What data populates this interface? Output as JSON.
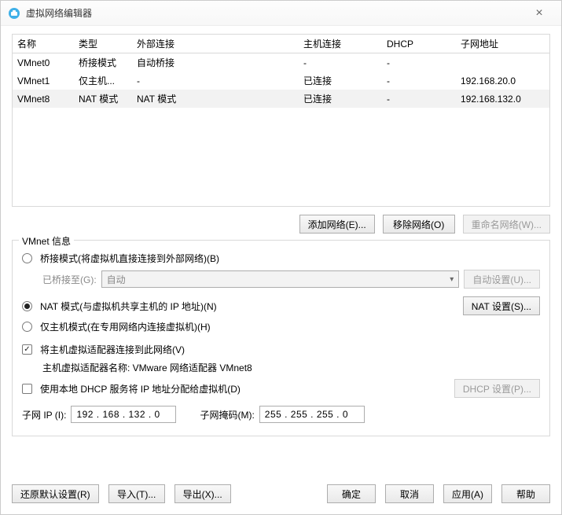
{
  "window": {
    "title": "虚拟网络编辑器"
  },
  "table": {
    "headers": {
      "name": "名称",
      "type": "类型",
      "ext": "外部连接",
      "host": "主机连接",
      "dhcp": "DHCP",
      "subnet": "子网地址"
    },
    "rows": [
      {
        "name": "VMnet0",
        "type": "桥接模式",
        "ext": "自动桥接",
        "host": "-",
        "dhcp": "-",
        "subnet": ""
      },
      {
        "name": "VMnet1",
        "type": "仅主机...",
        "ext": "-",
        "host": "已连接",
        "dhcp": "-",
        "subnet": "192.168.20.0"
      },
      {
        "name": "VMnet8",
        "type": "NAT 模式",
        "ext": "NAT 模式",
        "host": "已连接",
        "dhcp": "-",
        "subnet": "192.168.132.0"
      }
    ]
  },
  "netButtons": {
    "add": "添加网络(E)...",
    "remove": "移除网络(O)",
    "rename": "重命名网络(W)..."
  },
  "groupTitle": "VMnet 信息",
  "mode": {
    "bridge": "桥接模式(将虚拟机直接连接到外部网络)(B)",
    "bridgedToLabel": "已桥接至(G):",
    "bridgedToValue": "自动",
    "autoSet": "自动设置(U)...",
    "nat": "NAT 模式(与虚拟机共享主机的 IP 地址)(N)",
    "natSet": "NAT 设置(S)...",
    "hostonly": "仅主机模式(在专用网络内连接虚拟机)(H)"
  },
  "hostAdapter": {
    "check": "将主机虚拟适配器连接到此网络(V)",
    "nameLine": "主机虚拟适配器名称: VMware 网络适配器 VMnet8"
  },
  "dhcp": {
    "check": "使用本地 DHCP 服务将 IP 地址分配给虚拟机(D)",
    "set": "DHCP 设置(P)..."
  },
  "ip": {
    "subnetLabel": "子网 IP (I):",
    "subnetValue": "192 . 168 . 132 .   0",
    "maskLabel": "子网掩码(M):",
    "maskValue": "255 . 255 . 255 .   0"
  },
  "footer": {
    "restore": "还原默认设置(R)",
    "import": "导入(T)...",
    "export": "导出(X)...",
    "ok": "确定",
    "cancel": "取消",
    "apply": "应用(A)",
    "help": "帮助"
  }
}
